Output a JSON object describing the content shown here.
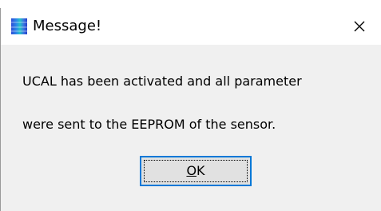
{
  "window": {
    "title": "Message!",
    "icon": "app-gradient-icon",
    "close_icon": "close-icon"
  },
  "message": {
    "line1": "UCAL has been activated and all parameter",
    "line2": "were sent to the EEPROM of the sensor."
  },
  "buttons": {
    "ok_mnemonic": "O",
    "ok_rest": "K"
  },
  "colors": {
    "accent": "#0078d7",
    "dialog_bg": "#f0f0f0",
    "titlebar_bg": "#ffffff",
    "button_bg": "#e1e1e1"
  }
}
